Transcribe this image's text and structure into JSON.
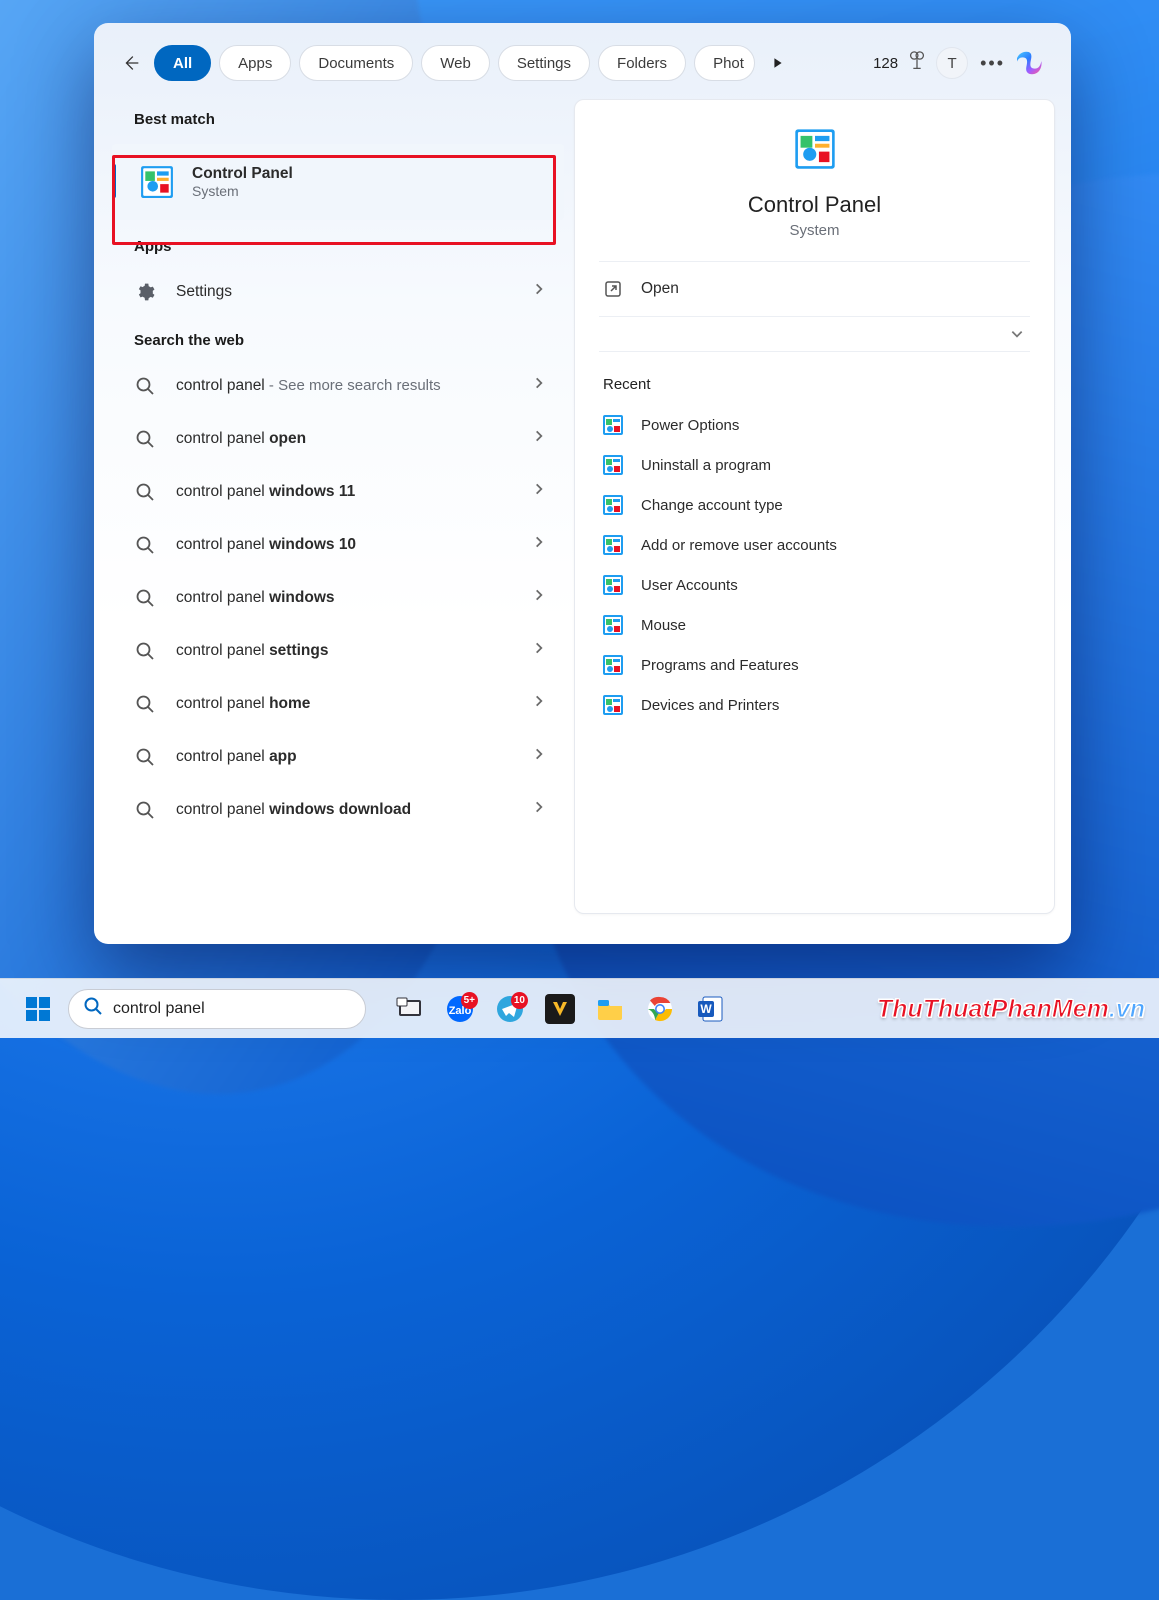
{
  "filters": {
    "all": "All",
    "apps": "Apps",
    "documents": "Documents",
    "web": "Web",
    "settings": "Settings",
    "folders": "Folders",
    "photos": "Phot"
  },
  "points": "128",
  "avatar_initial": "T",
  "sections": {
    "best_match": "Best match",
    "apps": "Apps",
    "search_web": "Search the web"
  },
  "best_match": {
    "title": "Control Panel",
    "subtitle": "System"
  },
  "apps_list": [
    {
      "label": "Settings"
    }
  ],
  "web_results": [
    {
      "text": "control panel",
      "suffix": " - See more search results"
    },
    {
      "prefix": "control panel ",
      "bold": "open"
    },
    {
      "prefix": "control panel ",
      "bold": "windows 11"
    },
    {
      "prefix": "control panel ",
      "bold": "windows 10"
    },
    {
      "prefix": "control panel ",
      "bold": "windows"
    },
    {
      "prefix": "control panel ",
      "bold": "settings"
    },
    {
      "prefix": "control panel ",
      "bold": "home"
    },
    {
      "prefix": "control panel ",
      "bold": "app"
    },
    {
      "prefix": "control panel ",
      "bold": "windows download"
    }
  ],
  "detail": {
    "title": "Control Panel",
    "subtitle": "System",
    "open": "Open",
    "recent_header": "Recent",
    "recent": [
      "Power Options",
      "Uninstall a program",
      "Change account type",
      "Add or remove user accounts",
      "User Accounts",
      "Mouse",
      "Programs and Features",
      "Devices and Printers"
    ]
  },
  "taskbar": {
    "search_value": "control panel",
    "badges": {
      "zalo": "5+",
      "telegram": "10"
    }
  },
  "watermark": {
    "a": "ThuThuat",
    "b": "PhanMem",
    "c": ".vn"
  }
}
